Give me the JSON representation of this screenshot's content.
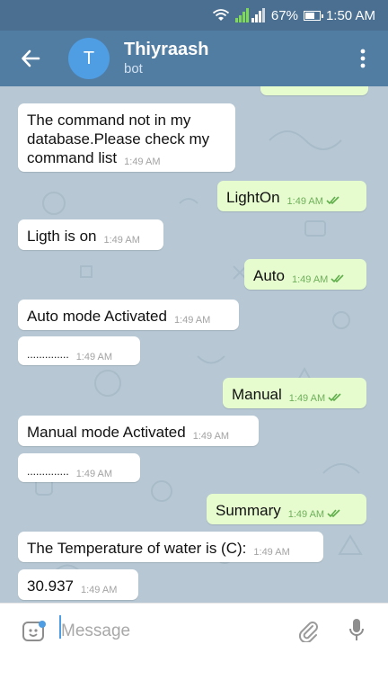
{
  "status_bar": {
    "battery": "67%",
    "time": "1:50 AM",
    "icons": [
      "wifi-icon",
      "signal-icon",
      "battery-icon"
    ]
  },
  "header": {
    "back_icon": "arrow-left-icon",
    "avatar_letter": "T",
    "title": "Thiyraash",
    "subtitle": "bot",
    "menu_icon": "more-vertical-icon"
  },
  "messages": [
    {
      "dir": "in",
      "text": "The command not in my database.Please check my command list",
      "time": "1:49 AM"
    },
    {
      "dir": "out",
      "text": "LightOn",
      "time": "1:49 AM",
      "status": "read"
    },
    {
      "dir": "in",
      "text": "Ligth is on",
      "time": "1:49 AM"
    },
    {
      "dir": "out",
      "text": "Auto",
      "time": "1:49 AM",
      "status": "read"
    },
    {
      "dir": "in",
      "text": "Auto mode Activated",
      "time": "1:49 AM"
    },
    {
      "dir": "in",
      "text": "..............",
      "time": "1:49 AM"
    },
    {
      "dir": "out",
      "text": "Manual",
      "time": "1:49 AM",
      "status": "read"
    },
    {
      "dir": "in",
      "text": "Manual mode Activated",
      "time": "1:49 AM"
    },
    {
      "dir": "in",
      "text": "..............",
      "time": "1:49 AM"
    },
    {
      "dir": "out",
      "text": "Summary",
      "time": "1:49 AM",
      "status": "read"
    },
    {
      "dir": "in",
      "text": "The Temperature of water is (C):",
      "time": "1:49 AM"
    },
    {
      "dir": "in",
      "text": "30.937",
      "time": "1:49 AM"
    }
  ],
  "composer": {
    "placeholder": "Message",
    "emoji_icon": "sticker-icon",
    "attach_icon": "paperclip-icon",
    "mic_icon": "microphone-icon"
  },
  "colors": {
    "status_bar": "#4a6f90",
    "toolbar": "#527da3",
    "avatar": "#4f9de3",
    "chat_bg": "#b7c8d4",
    "incoming_bubble": "#ffffff",
    "outgoing_bubble": "#e6fccf",
    "read_check": "#5fae4a"
  }
}
